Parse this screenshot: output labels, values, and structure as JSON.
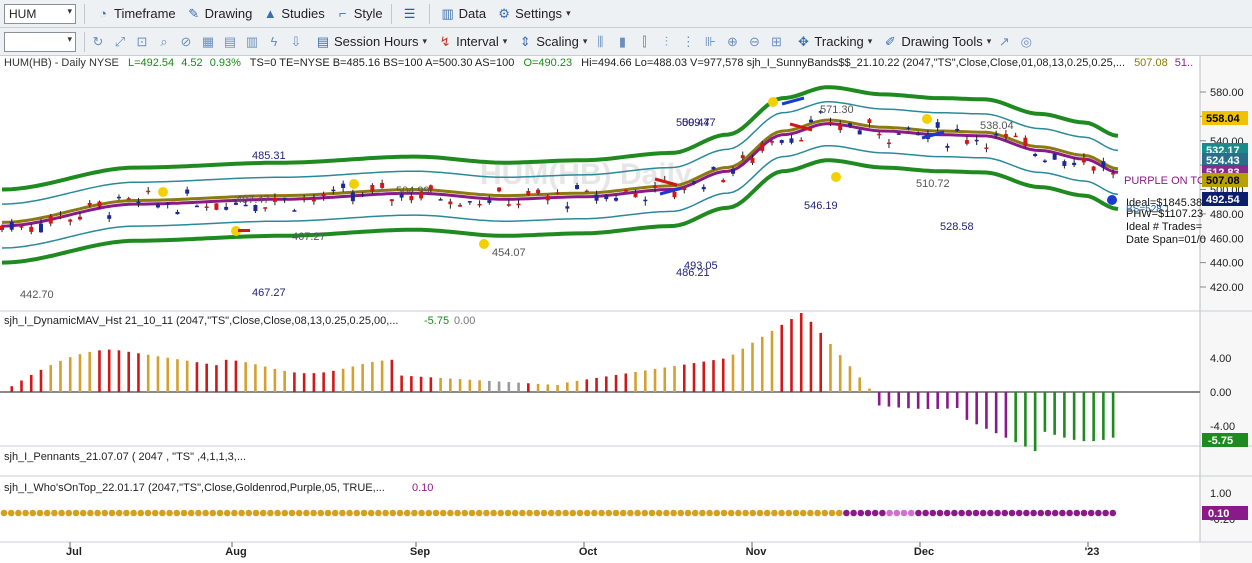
{
  "toolbar1": {
    "symbol": "HUM",
    "items": [
      {
        "label": "Timeframe",
        "icon": "clock-icon"
      },
      {
        "label": "Drawing",
        "icon": "pencil-icon"
      },
      {
        "label": "Studies",
        "icon": "studies-icon"
      },
      {
        "label": "Style",
        "icon": "style-icon"
      },
      {
        "label": "",
        "icon": "layout-icon"
      },
      {
        "label": "Data",
        "icon": "data-icon"
      },
      {
        "label": "Settings",
        "icon": "gear-icon"
      }
    ]
  },
  "toolbar2": {
    "session_hours": "Session Hours",
    "interval": "Interval",
    "scaling": "Scaling",
    "tracking": "Tracking",
    "drawing_tools": "Drawing Tools"
  },
  "header": {
    "title": "HUM(HB) - Daily  NYSE",
    "last": "L=492.54",
    "change": "4.52",
    "pct": "0.93%",
    "rest": "TS=0  TE=NYSE  B=485.16  BS=100  A=500.30  AS=100",
    "open": "O=490.23",
    "hilo": "Hi=494.66  Lo=488.03  V=977,578  sjh_I_SunnyBands$$_21.10.22 (2047,\"TS\",Close,Close,01,08,13,0.25,0.25,...",
    "band_val": "507.08",
    "band_val2": "51.."
  },
  "watermark": "HUM(HB) Daily",
  "price_axis": [
    "580.00",
    "560.00",
    "540.00",
    "520.00",
    "500.00",
    "480.00",
    "460.00",
    "440.00",
    "420.00"
  ],
  "price_flags": [
    {
      "value": "558.04",
      "color": "#f2c200",
      "text": "#000"
    },
    {
      "value": "532.17",
      "color": "#1a8a8a",
      "text": "#fff"
    },
    {
      "value": "524.43",
      "color": "#2a6f8a",
      "text": "#fff"
    },
    {
      "value": "512.83",
      "color": "#8a2a8a",
      "text": "#fff"
    },
    {
      "value": "507.08",
      "color": "#b8a000",
      "text": "#000"
    },
    {
      "value": "492.54",
      "color": "#0b1e6e",
      "text": "#fff"
    }
  ],
  "annotations": {
    "a485": "485.31",
    "a467a": "467.27",
    "a467b": "467.27",
    "a497": "497.47",
    "a504": "504.99",
    "a454": "454.07",
    "a442": "442.70",
    "a509a": "509.47",
    "a509b": "509.47",
    "a493": "493.05",
    "a486": "486.21",
    "a571": "571.30",
    "a546": "546.19",
    "a510": "510.72",
    "a528": "528.58",
    "a538": "538.04",
    "purple": "PURPLE ON TO",
    "ideal": "Ideal=$1845.38",
    "phw": "PHW=$1107.23",
    "trades": "Ideal # Trades=",
    "span": "Date Span=01/0",
    "bs": "BS=528.1"
  },
  "panel2": {
    "label": "sjh_I_DynamicMAV_Hst 21_10_11 (2047,\"TS\",Close,Close,08,13,0.25,0.25,00,...",
    "v1": "-5.75",
    "v2": "0.00",
    "axis": [
      "4.00",
      "0.00",
      "-4.00"
    ],
    "flag": "-5.75"
  },
  "panel3": {
    "label": "sjh_I_Pennants_21.07.07 ( 2047 , \"TS\" ,4,1,1,3,..."
  },
  "panel4": {
    "label": "sjh_I_Who'sOnTop_22.01.17 (2047,\"TS\",Close,Goldenrod,Purple,05, TRUE,...",
    "value": "0.10",
    "axis": [
      "1.00",
      "-0.20"
    ],
    "flag": "0.10"
  },
  "months": [
    "Jul",
    "Aug",
    "Sep",
    "Oct",
    "Nov",
    "Dec",
    "'23"
  ]
}
